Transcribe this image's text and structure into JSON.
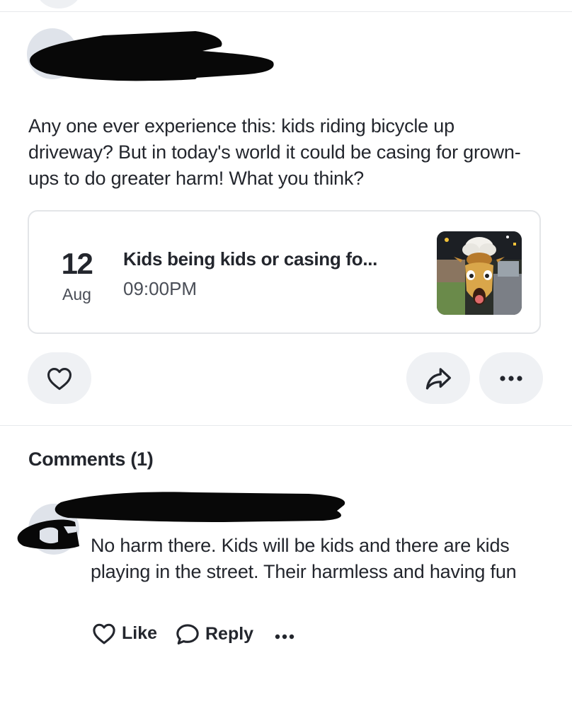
{
  "post": {
    "body": "Any one ever experience this: kids  riding bicycle up driveway? But in today's world it could be casing for grown-ups to do greater harm! What you think?",
    "event": {
      "day": "12",
      "month": "Aug",
      "title": "Kids being kids or casing fo...",
      "time": "09:00PM",
      "thumbnail_icon": "video-thumbnail-cartoon-giraffe"
    },
    "actions": {
      "like_icon": "heart-icon",
      "share_icon": "share-arrow-icon",
      "more_icon": "ellipsis-icon"
    }
  },
  "comments": {
    "heading": "Comments (1)",
    "items": [
      {
        "text": "No harm there. Kids will be kids and there are kids playing in the street. Their harmless and having fun",
        "like_label": "Like",
        "reply_label": "Reply"
      }
    ]
  },
  "colors": {
    "text": "#23262d",
    "muted": "#4a4e57",
    "pill_bg": "#eff1f4",
    "border": "#e3e5e8",
    "redaction": "#080808"
  }
}
